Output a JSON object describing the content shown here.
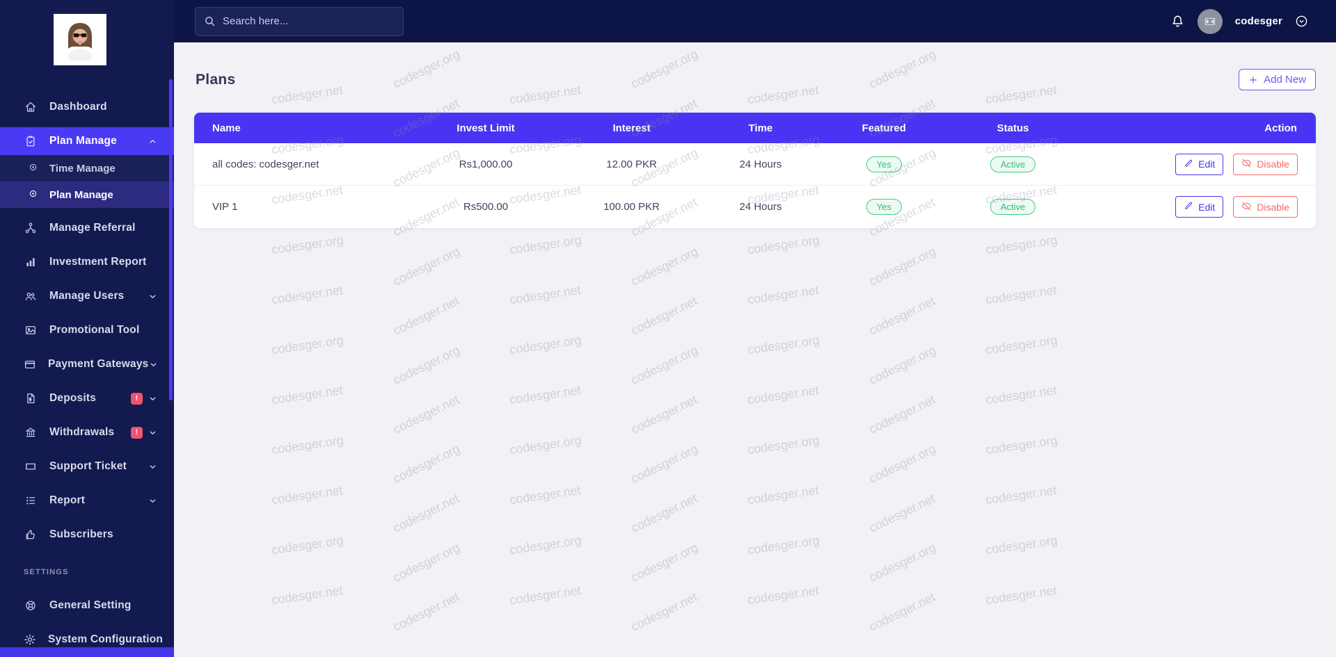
{
  "topbar": {
    "search_placeholder": "Search here...",
    "username": "codesger"
  },
  "sidebar": {
    "items": [
      {
        "label": "Dashboard",
        "icon": "home-icon"
      },
      {
        "label": "Plan Manage",
        "icon": "clipboard-check-icon",
        "active": true,
        "chevron": "up",
        "children": [
          {
            "label": "Time Manage",
            "icon": "dot-circle-icon",
            "active": false
          },
          {
            "label": "Plan Manage",
            "icon": "dot-circle-icon",
            "active": true
          }
        ]
      },
      {
        "label": "Manage Referral",
        "icon": "referral-tree-icon"
      },
      {
        "label": "Investment Report",
        "icon": "bar-chart-icon"
      },
      {
        "label": "Manage Users",
        "icon": "users-icon",
        "chevron": "down"
      },
      {
        "label": "Promotional Tool",
        "icon": "promo-image-icon"
      },
      {
        "label": "Payment Gateways",
        "icon": "credit-card-icon",
        "chevron": "down"
      },
      {
        "label": "Deposits",
        "icon": "invoice-dollar-icon",
        "badge": "!",
        "chevron": "down"
      },
      {
        "label": "Withdrawals",
        "icon": "bank-icon",
        "badge": "!",
        "chevron": "down"
      },
      {
        "label": "Support Ticket",
        "icon": "ticket-icon",
        "chevron": "down"
      },
      {
        "label": "Report",
        "icon": "report-list-icon",
        "chevron": "down"
      },
      {
        "label": "Subscribers",
        "icon": "thumbs-up-icon"
      }
    ],
    "section_label": "SETTINGS",
    "settings_items": [
      {
        "label": "General Setting",
        "icon": "life-ring-icon"
      },
      {
        "label": "System Configuration",
        "icon": "gear-icon"
      }
    ]
  },
  "page": {
    "title": "Plans",
    "add_button_label": "Add New"
  },
  "table": {
    "columns": [
      "Name",
      "Invest Limit",
      "Interest",
      "Time",
      "Featured",
      "Status",
      "Action"
    ],
    "rows": [
      {
        "name": "all codes: codesger.net",
        "invest_limit": "Rs1,000.00",
        "interest": "12.00 PKR",
        "time": "24 Hours",
        "featured": "Yes",
        "status": "Active",
        "actions": [
          "Edit",
          "Disable"
        ]
      },
      {
        "name": "VIP 1",
        "invest_limit": "Rs500.00",
        "interest": "100.00 PKR",
        "time": "24 Hours",
        "featured": "Yes",
        "status": "Active",
        "actions": [
          "Edit",
          "Disable"
        ]
      }
    ]
  },
  "watermarks": {
    "texts": [
      "codesger.net",
      "codesger.org"
    ]
  },
  "colors": {
    "accent": "#4834F2",
    "sidebar_active": "#4B3AF3",
    "danger": "#F46A6A",
    "success": "#2FBE72",
    "badge_red": "#F4516C"
  }
}
